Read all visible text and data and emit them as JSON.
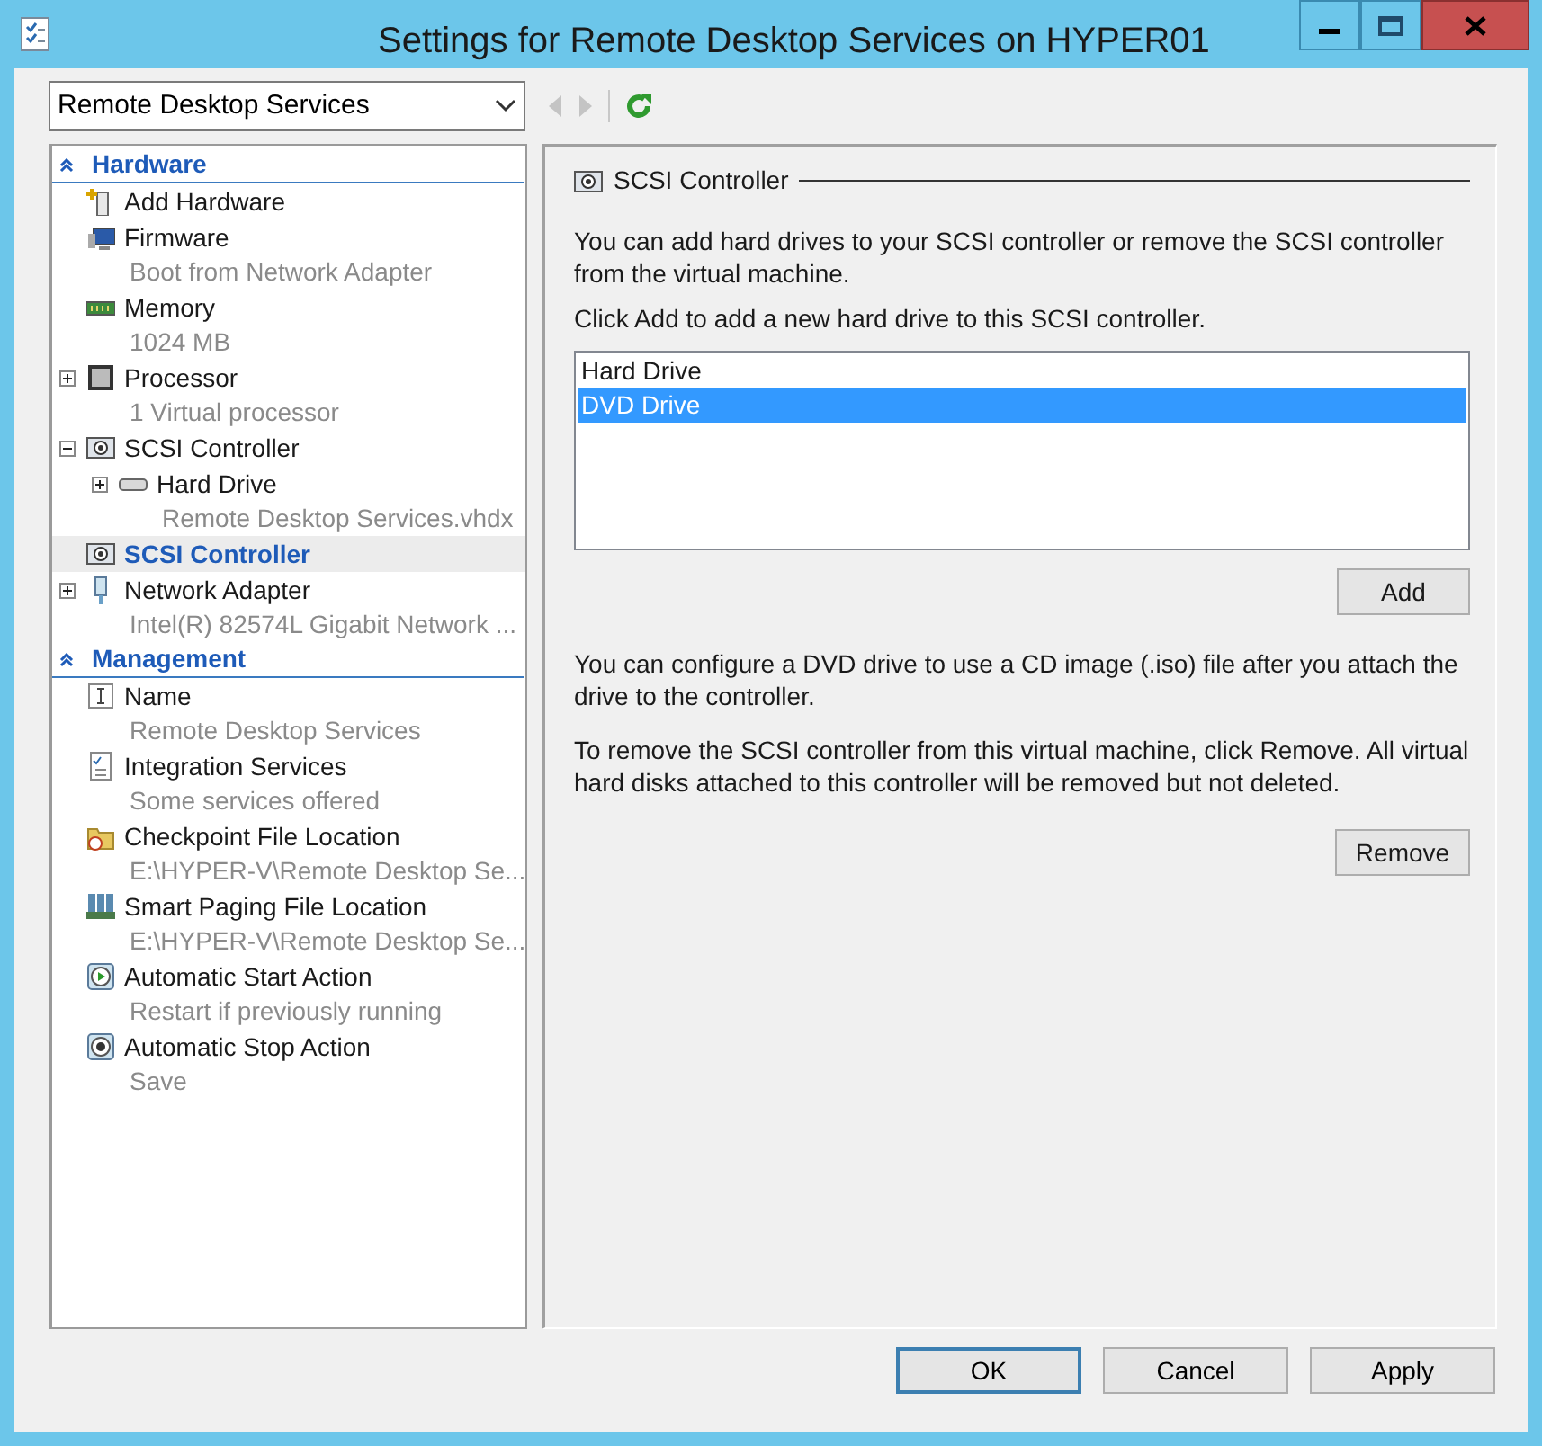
{
  "window": {
    "title": "Settings for Remote Desktop Services on HYPER01"
  },
  "vm_selector": {
    "value": "Remote Desktop Services"
  },
  "nav": [
    {
      "kind": "back",
      "disabled": true
    },
    {
      "kind": "forward",
      "disabled": true
    },
    {
      "kind": "refresh",
      "disabled": false
    }
  ],
  "sidebar": {
    "sections": [
      {
        "title": "Hardware",
        "items": [
          {
            "kind": "add",
            "name": "Add Hardware",
            "selected": false
          },
          {
            "kind": "firmware",
            "name": "Firmware",
            "subtitle": "Boot from Network Adapter",
            "selected": false
          },
          {
            "kind": "memory",
            "name": "Memory",
            "subtitle": "1024 MB",
            "selected": false
          },
          {
            "kind": "processor",
            "name": "Processor",
            "subtitle": "1 Virtual processor",
            "expanded": false,
            "selected": false
          },
          {
            "kind": "scsi",
            "name": "SCSI Controller",
            "expanded": true,
            "selected": false,
            "children": [
              {
                "kind": "disk",
                "name": "Hard Drive",
                "subtitle": "Remote Desktop Services.vhdx",
                "expanded": false,
                "selected": false
              }
            ]
          },
          {
            "kind": "scsi",
            "name": "SCSI Controller",
            "selected": true
          },
          {
            "kind": "network",
            "name": "Network Adapter",
            "subtitle": "Intel(R) 82574L Gigabit Network ...",
            "expanded": false,
            "selected": false
          }
        ]
      },
      {
        "title": "Management",
        "items": [
          {
            "kind": "name",
            "name": "Name",
            "subtitle": "Remote Desktop Services",
            "selected": false
          },
          {
            "kind": "integration",
            "name": "Integration Services",
            "subtitle": "Some services offered",
            "selected": false
          },
          {
            "kind": "checkpoint",
            "name": "Checkpoint File Location",
            "subtitle": "E:\\HYPER-V\\Remote Desktop Se...",
            "selected": false
          },
          {
            "kind": "paging",
            "name": "Smart Paging File Location",
            "subtitle": "E:\\HYPER-V\\Remote Desktop Se...",
            "selected": false
          },
          {
            "kind": "start",
            "name": "Automatic Start Action",
            "subtitle": "Restart if previously running",
            "selected": false
          },
          {
            "kind": "stop",
            "name": "Automatic Stop Action",
            "subtitle": "Save",
            "selected": false
          }
        ]
      }
    ]
  },
  "panel": {
    "title": "SCSI Controller",
    "intro": "You can add hard drives to your SCSI controller or remove the SCSI controller from the virtual machine.",
    "instruction": "Click Add to add a new hard drive to this SCSI controller.",
    "drive_types": [
      {
        "label": "Hard Drive",
        "selected": false
      },
      {
        "label": "DVD Drive",
        "selected": true
      }
    ],
    "add_button": "Add",
    "dvd_note": "You can configure a DVD drive to use a CD image (.iso) file after you attach the drive to the controller.",
    "remove_note": "To remove the SCSI controller from this virtual machine, click Remove. All virtual hard disks attached to this controller will be removed but not deleted.",
    "remove_button": "Remove"
  },
  "buttons": [
    {
      "label": "OK",
      "default": true
    },
    {
      "label": "Cancel",
      "default": false
    },
    {
      "label": "Apply",
      "default": false
    }
  ]
}
